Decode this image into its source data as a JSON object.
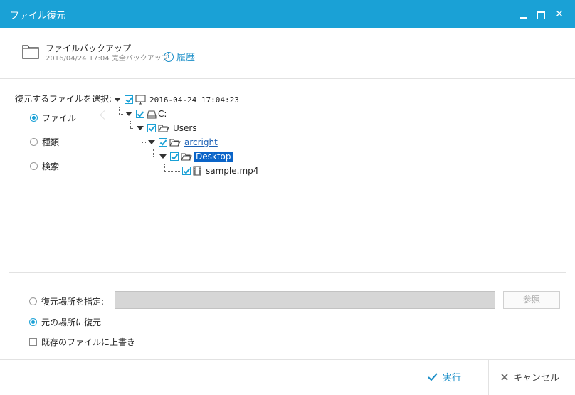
{
  "window": {
    "title": "ファイル復元"
  },
  "header": {
    "title": "ファイルバックアップ",
    "subtitle": "2016/04/24 17:04 完全バックアップ",
    "history_label": "履歴",
    "info_glyph": "i",
    "icon": "folder-icon"
  },
  "left_panel": {
    "label": "復元するファイルを選択:",
    "options": [
      "ファイル",
      "種類",
      "検索"
    ],
    "selected": "ファイル"
  },
  "tree": {
    "items": [
      {
        "label": "2016-04-24 17:04:23",
        "icon": "computer-icon",
        "checked": true
      },
      {
        "label": "C:",
        "icon": "drive-icon",
        "checked": true
      },
      {
        "label": "Users",
        "icon": "folder-open-icon",
        "checked": true
      },
      {
        "label": "arcright",
        "icon": "folder-open-icon",
        "checked": true
      },
      {
        "label": "Desktop",
        "icon": "folder-open-icon",
        "checked": true,
        "selected": true
      },
      {
        "label": "sample.mp4",
        "icon": "video-file-icon",
        "checked": true
      }
    ]
  },
  "restore": {
    "option_custom": "復元場所を指定:",
    "option_original": "元の場所に復元",
    "selected": "元の場所に復元",
    "path_value": "",
    "browse_label": "参照",
    "overwrite_label": "既存のファイルに上書き",
    "overwrite_checked": false
  },
  "footer": {
    "run_label": "実行",
    "cancel_label": "キャンセル"
  },
  "colors": {
    "accent": "#1aa1d6",
    "link": "#1a8ec8",
    "selection": "#0a64c8"
  }
}
